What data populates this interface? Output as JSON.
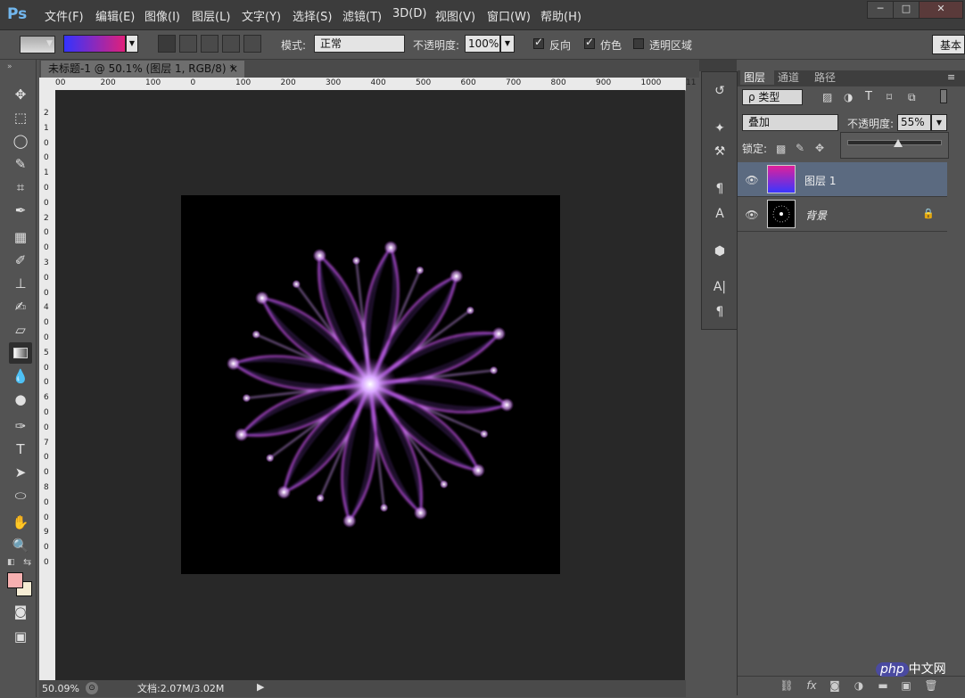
{
  "app": {
    "logo": "Ps"
  },
  "menu": [
    "文件(F)",
    "编辑(E)",
    "图像(I)",
    "图层(L)",
    "文字(Y)",
    "选择(S)",
    "滤镜(T)",
    "3D(D)",
    "视图(V)",
    "窗口(W)",
    "帮助(H)"
  ],
  "window_controls": {
    "minimize": "─",
    "maximize": "□",
    "close": "✕"
  },
  "options": {
    "gradient_colors": [
      "#3333ff",
      "#e0207a"
    ],
    "mode_label": "模式:",
    "mode_value": "正常",
    "opacity_label": "不透明度:",
    "opacity_value": "100%",
    "reverse_label": "反向",
    "reverse_checked": true,
    "dither_label": "仿色",
    "dither_checked": true,
    "transparency_label": "透明区域",
    "transparency_checked": false,
    "workspace_label": "基本"
  },
  "document": {
    "tab_title": "未标题-1 @ 50.1% (图层 1, RGB/8) *",
    "close_glyph": "×",
    "ruler_h": [
      "00",
      "200",
      "100",
      "0",
      "100",
      "200",
      "300",
      "400",
      "500",
      "600",
      "700",
      "800",
      "900",
      "1000",
      "11"
    ],
    "ruler_v": [
      "2",
      "1",
      "0",
      "0",
      "1",
      "0",
      "0",
      "2",
      "0",
      "0",
      "3",
      "0",
      "0",
      "4",
      "0",
      "0",
      "5",
      "0",
      "0",
      "6",
      "0",
      "0",
      "7",
      "0",
      "0",
      "8",
      "0",
      "0",
      "9",
      "0",
      "0"
    ]
  },
  "status": {
    "zoom": "50.09%",
    "doc_info": "文档:2.07M/3.02M"
  },
  "tools": [
    "move-icon",
    "marquee-icon",
    "lasso-icon",
    "quick-select-icon",
    "crop-icon",
    "eyedropper-icon",
    "healing-icon",
    "brush-icon",
    "stamp-icon",
    "history-brush-icon",
    "eraser-icon",
    "gradient-icon",
    "blur-icon",
    "dodge-icon",
    "pen-icon",
    "type-icon",
    "path-select-icon",
    "ellipse-icon",
    "hand-icon",
    "zoom-icon"
  ],
  "colors": {
    "foreground": "#f7b0b0",
    "background": "#f6ecd4",
    "accent_selected_layer": "#5b6a80"
  },
  "layers_panel": {
    "tabs": [
      "图层",
      "通道",
      "路径"
    ],
    "filter_label": "ρ 类型",
    "blend_mode": "叠加",
    "opacity_label": "不透明度:",
    "opacity_value": "55%",
    "opacity_slider_fraction": 0.55,
    "lock_label": "锁定:",
    "layers": [
      {
        "name": "图层 1",
        "selected": true,
        "locked": false
      },
      {
        "name": "背景",
        "selected": false,
        "locked": true
      }
    ]
  },
  "watermark": {
    "brand": "php",
    "suffix": "中文网"
  }
}
